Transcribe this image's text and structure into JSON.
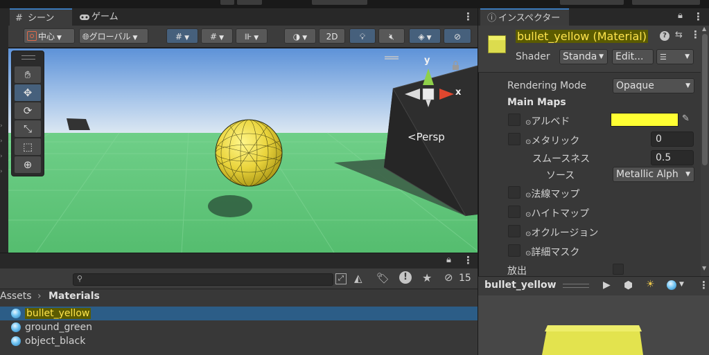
{
  "scene_tabs": [
    {
      "label": "シーン",
      "icon": "grid-icon"
    },
    {
      "label": "ゲーム",
      "icon": "gamepad-icon"
    }
  ],
  "scene_toolbar": {
    "pivot_label": "中心",
    "space_label": "グローバル",
    "mode_2d_label": "2D"
  },
  "scene_view": {
    "gizmo_y": "y",
    "gizmo_x": "x",
    "projection_label": "<Persp"
  },
  "project": {
    "hidden_count": "15",
    "breadcrumb_root": "Assets",
    "breadcrumb_current": "Materials",
    "files": [
      {
        "name": "bullet_yellow",
        "selected": true
      },
      {
        "name": "ground_green",
        "selected": false
      },
      {
        "name": "object_black",
        "selected": false
      }
    ]
  },
  "inspector": {
    "tab_label": "インスペクター",
    "title": "bullet_yellow (Material)",
    "shader_label": "Shader",
    "shader_value": "Standa",
    "edit_button": "Edit...",
    "rendering_mode_label": "Rendering Mode",
    "rendering_mode_value": "Opaque",
    "main_maps_label": "Main Maps",
    "albedo_label": "アルベド",
    "albedo_color": "#ffff33",
    "metallic_label": "メタリック",
    "metallic_value": "0",
    "smoothness_label": "スムースネス",
    "smoothness_value": "0.5",
    "source_label": "ソース",
    "source_value": "Metallic Alph",
    "normal_map_label": "法線マップ",
    "height_map_label": "ハイトマップ",
    "occlusion_label": "オクルージョン",
    "detail_mask_label": "詳細マスク",
    "emission_label": "放出"
  },
  "preview": {
    "title": "bullet_yellow"
  },
  "colors": {
    "accent_blue": "#3a79bb",
    "selection_blue": "#2c5d87",
    "highlight_text": "#ffe44d",
    "albedo": "#ffff33"
  }
}
